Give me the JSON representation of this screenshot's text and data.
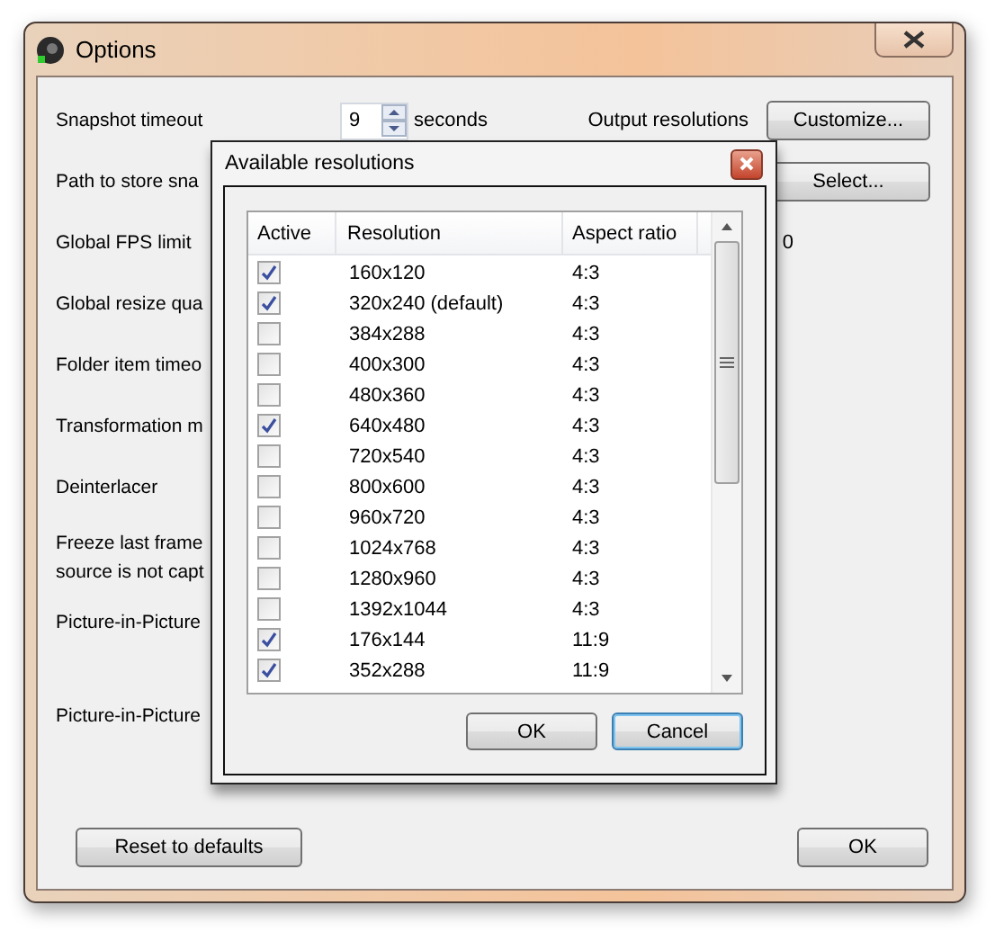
{
  "window": {
    "title": "Options"
  },
  "settings": [
    {
      "kind": "spinner",
      "label": "Snapshot timeout",
      "value": "9",
      "unit": "seconds",
      "extra_label": "Output resolutions",
      "button": "Customize..."
    },
    {
      "kind": "button",
      "label": "Path to store sna",
      "button": "Select..."
    },
    {
      "kind": "value",
      "label": "Global FPS limit",
      "value": "0"
    },
    {
      "kind": "plain",
      "label": "Global resize qua"
    },
    {
      "kind": "plain",
      "label": "Folder item timeo"
    },
    {
      "kind": "plain",
      "label": "Transformation m"
    },
    {
      "kind": "plain",
      "label": "Deinterlacer"
    },
    {
      "kind": "tall",
      "label": "Freeze last frame\nsource is not capt"
    },
    {
      "kind": "wide",
      "label": "Picture-in-Picture"
    },
    {
      "kind": "wide",
      "label": "Picture-in-Picture"
    }
  ],
  "footer_buttons": [
    {
      "label": "Reset to defaults"
    },
    {
      "label": "OK"
    }
  ],
  "dialog": {
    "title": "Available resolutions",
    "columns": [
      "Active",
      "Resolution",
      "Aspect ratio"
    ],
    "rows": [
      {
        "active": true,
        "resolution": "160x120",
        "aspect_ratio": "4:3"
      },
      {
        "active": true,
        "resolution": "320x240 (default)",
        "aspect_ratio": "4:3"
      },
      {
        "active": false,
        "resolution": "384x288",
        "aspect_ratio": "4:3"
      },
      {
        "active": false,
        "resolution": "400x300",
        "aspect_ratio": "4:3"
      },
      {
        "active": false,
        "resolution": "480x360",
        "aspect_ratio": "4:3"
      },
      {
        "active": true,
        "resolution": "640x480",
        "aspect_ratio": "4:3"
      },
      {
        "active": false,
        "resolution": "720x540",
        "aspect_ratio": "4:3"
      },
      {
        "active": false,
        "resolution": "800x600",
        "aspect_ratio": "4:3"
      },
      {
        "active": false,
        "resolution": "960x720",
        "aspect_ratio": "4:3"
      },
      {
        "active": false,
        "resolution": "1024x768",
        "aspect_ratio": "4:3"
      },
      {
        "active": false,
        "resolution": "1280x960",
        "aspect_ratio": "4:3"
      },
      {
        "active": false,
        "resolution": "1392x1044",
        "aspect_ratio": "4:3"
      },
      {
        "active": true,
        "resolution": "176x144",
        "aspect_ratio": "11:9"
      },
      {
        "active": true,
        "resolution": "352x288",
        "aspect_ratio": "11:9"
      }
    ],
    "buttons": [
      {
        "label": "OK",
        "focused": false
      },
      {
        "label": "Cancel",
        "focused": true
      }
    ]
  }
}
